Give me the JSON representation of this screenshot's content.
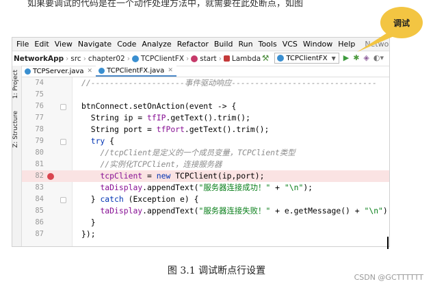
{
  "doc": {
    "top_text": "如果要调试的代码是在一个动作处理方法中，就需要在此处断点，如图",
    "caption": "图 3.1  调试断点行设置",
    "watermark": "CSDN @GCTTTTTT",
    "callout_label": "调试",
    "callout_color": "#f3c542"
  },
  "menubar": {
    "items": [
      "File",
      "Edit",
      "View",
      "Navigate",
      "Code",
      "Analyze",
      "Refactor",
      "Build",
      "Run",
      "Tools",
      "VCS",
      "Window",
      "Help"
    ],
    "project_title": "NetworkApp"
  },
  "navbar": {
    "project": "NetworkApp",
    "src": "src",
    "package": "chapter02",
    "class": "TCPClientFX",
    "method": "start",
    "lambda": "Lambda",
    "run_config": "TCPClientFX",
    "icons": [
      "hammer-icon",
      "run-icon",
      "debug-icon",
      "coverage-icon",
      "profile-icon"
    ]
  },
  "side_tabs": {
    "project": "1: Project",
    "structure": "Z: Structure"
  },
  "tabs": [
    {
      "label": "TCPServer.java",
      "active": false
    },
    {
      "label": "TCPClientFX.java",
      "active": true
    }
  ],
  "editor": {
    "breakpoint_line": 82,
    "lines": [
      {
        "n": "74",
        "t": "//--------------------事件驱动响应-------------------------------"
      },
      {
        "n": "75",
        "t": ""
      },
      {
        "n": "76",
        "t": "btnConnect.setOnAction(event -> {"
      },
      {
        "n": "77",
        "t": "  String ip = tfIP.getText().trim();"
      },
      {
        "n": "78",
        "t": "  String port = tfPort.getText().trim();"
      },
      {
        "n": "79",
        "t": "  try {"
      },
      {
        "n": "80",
        "t": "    //tcpClient是定义的一个成员变量，TCPClient类型"
      },
      {
        "n": "81",
        "t": "    //实例化TCPClient，连接服务器"
      },
      {
        "n": "82",
        "t": "    tcpClient = new TCPClient(ip,port);"
      },
      {
        "n": "83",
        "t": "    taDisplay.appendText(\"服务器连接成功！\" + \"\\n\");"
      },
      {
        "n": "84",
        "t": "  } catch (Exception e) {"
      },
      {
        "n": "85",
        "t": "    taDisplay.appendText(\"服务器连接失败！\" + e.getMessage() + \"\\n\");"
      },
      {
        "n": "86",
        "t": "  }"
      },
      {
        "n": "87",
        "t": "});"
      }
    ]
  },
  "colors": {
    "keyword": "#0033b3",
    "field": "#871094",
    "string": "#067d17",
    "comment": "#8c8c8c",
    "breakpoint": "#d9454f",
    "breakpoint_line_bg": "#fae3e3"
  }
}
